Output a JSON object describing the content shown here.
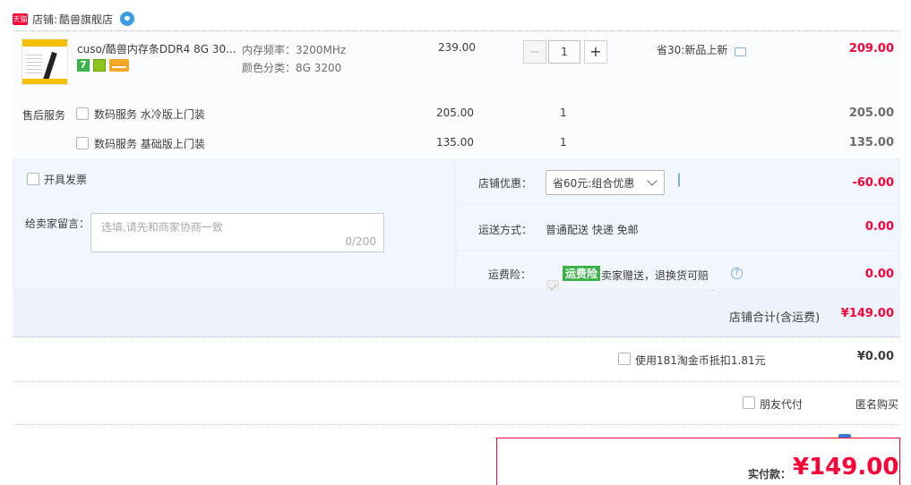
{
  "shop": {
    "badge": "天猫",
    "label": "店铺:",
    "name": "酷兽旗舰店"
  },
  "item": {
    "title": "cuso/酷兽内存条DDR4 8G 30...",
    "badge_7": "7",
    "sku_freq": "内存频率：3200MHz",
    "sku_color": "颜色分类：8G 3200",
    "unit_price": "239.00",
    "qty": "1",
    "qty_minus": "−",
    "qty_plus": "+",
    "promo": "省30:新品上新",
    "subtotal": "209.00"
  },
  "services": {
    "section_label": "售后服务",
    "rows": [
      {
        "label": "数码服务 水冷版上门装",
        "price": "205.00",
        "qty": "1",
        "total": "205.00"
      },
      {
        "label": "数码服务 基础版上门装",
        "price": "135.00",
        "qty": "1",
        "total": "135.00"
      }
    ]
  },
  "invoice": {
    "label": "开具发票"
  },
  "memo": {
    "label": "给卖家留言：",
    "placeholder": "选填,请先和商家协商一致",
    "count": "0/200"
  },
  "discount": {
    "label": "店铺优惠：",
    "selected": "省60元:组合优惠",
    "amount": "-60.00"
  },
  "shipping": {
    "label": "运送方式：",
    "value": "普通配送 快递 免邮",
    "amount": "0.00"
  },
  "insurance": {
    "label": "运费险：",
    "tag": "运费险",
    "desc": "卖家赠送，退换货可赔",
    "help": "?",
    "amount": "0.00"
  },
  "shop_total": {
    "label": "店铺合计(含运费)",
    "amount": "¥149.00"
  },
  "coins": {
    "label": "使用181淘金币抵扣1.81元",
    "amount": "¥0.00"
  },
  "options": {
    "friend_pay": "朋友代付",
    "anonymous": "匿名购买"
  },
  "payment": {
    "label": "实付款：",
    "amount": "¥149.00"
  },
  "colors": {
    "accent_red": "#ff0036",
    "panel_blue": "#eef3fb",
    "tag_green": "#3bb34a"
  }
}
